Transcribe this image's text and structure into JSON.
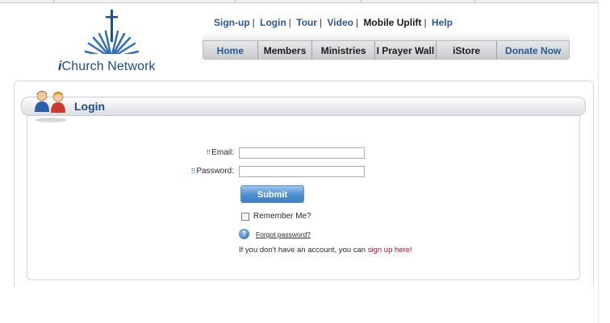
{
  "logo": {
    "prefix": "i",
    "name": "Church Network"
  },
  "top_links": [
    {
      "label": "Sign-up"
    },
    {
      "label": "Login"
    },
    {
      "label": "Tour"
    },
    {
      "label": "Video"
    },
    {
      "label": "Mobile Uplift"
    },
    {
      "label": "Help"
    }
  ],
  "nav": {
    "tabs": [
      {
        "label": "Home"
      },
      {
        "label": "Members"
      },
      {
        "label": "Ministries"
      },
      {
        "label": "I Prayer Wall"
      },
      {
        "label": "iStore"
      },
      {
        "label": "Donate Now"
      }
    ]
  },
  "panel": {
    "title": "Login"
  },
  "form": {
    "email_label": "Email:",
    "password_label": "Password:",
    "email_value": "",
    "password_value": "",
    "submit_label": "Submit",
    "remember_label": "Remember Me?",
    "forgot_label": "Forgot password?",
    "no_account_text": "If you don't have an account, you can ",
    "sign_up_link": "sign up here!"
  },
  "colors": {
    "brand_blue": "#1f4d8f",
    "link_red": "#b30d2b",
    "button_blue": "#4f8fd0"
  }
}
